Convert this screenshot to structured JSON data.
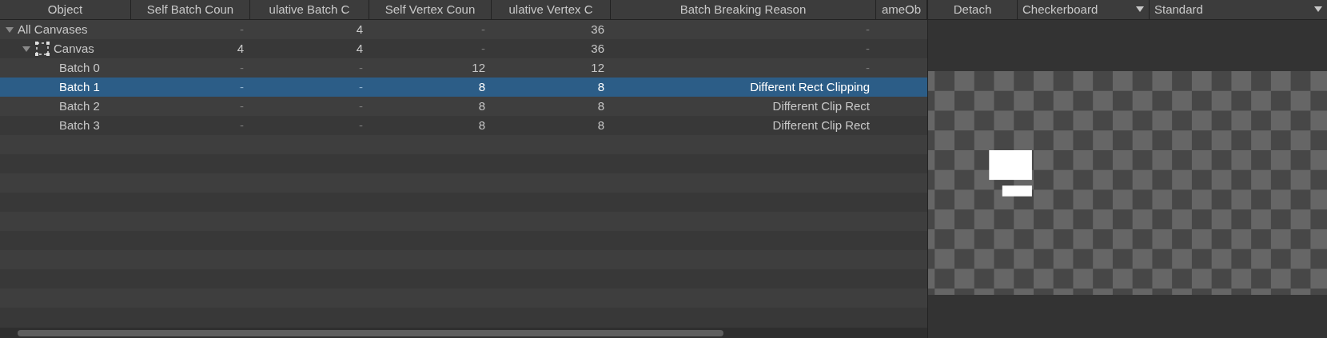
{
  "table": {
    "columns": [
      {
        "label": "Object"
      },
      {
        "label": "Self Batch Coun"
      },
      {
        "label": "ulative Batch C"
      },
      {
        "label": "Self Vertex Coun"
      },
      {
        "label": "ulative Vertex C"
      },
      {
        "label": "Batch Breaking Reason"
      },
      {
        "label": "ameOb"
      }
    ],
    "rows": [
      {
        "name": "All Canvases",
        "expanded": true,
        "selected": false,
        "cells": [
          "-",
          "4",
          "-",
          "36",
          "-"
        ],
        "children": [
          {
            "name": "Canvas",
            "canvas_icon": true,
            "expanded": true,
            "selected": false,
            "cells": [
              "4",
              "4",
              "-",
              "36",
              "-"
            ],
            "children": [
              {
                "name": "Batch 0",
                "selected": false,
                "cells": [
                  "-",
                  "-",
                  "12",
                  "12",
                  "-"
                ]
              },
              {
                "name": "Batch 1",
                "selected": true,
                "cells": [
                  "-",
                  "-",
                  "8",
                  "8",
                  "Different Rect Clipping"
                ]
              },
              {
                "name": "Batch 2",
                "selected": false,
                "cells": [
                  "-",
                  "-",
                  "8",
                  "8",
                  "Different Clip Rect"
                ]
              },
              {
                "name": "Batch 3",
                "selected": false,
                "cells": [
                  "-",
                  "-",
                  "8",
                  "8",
                  "Different Clip Rect"
                ]
              }
            ]
          }
        ]
      }
    ]
  },
  "preview_toolbar": {
    "detach": "Detach",
    "background": "Checkerboard",
    "mode": "Standard"
  }
}
